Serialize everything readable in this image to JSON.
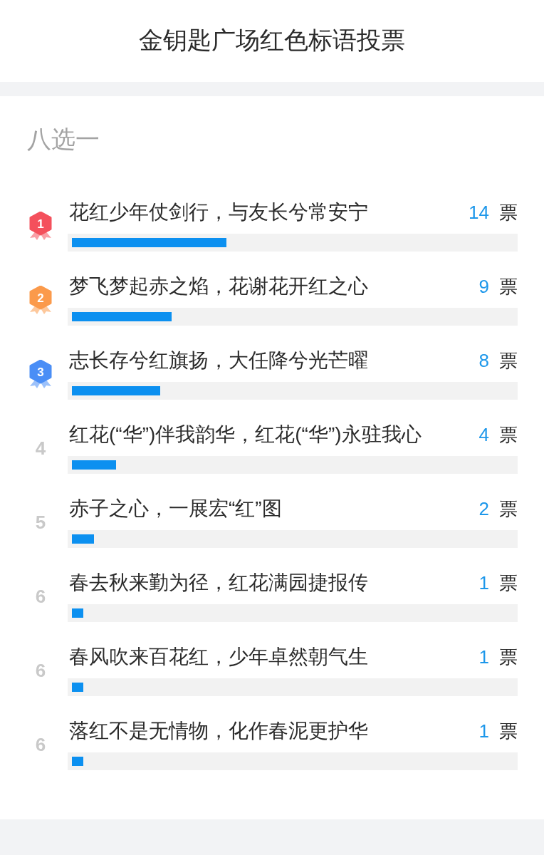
{
  "header": {
    "title": "金钥匙广场红色标语投票"
  },
  "poll": {
    "subtitle": "八选一",
    "options": [
      {
        "kind": "medal",
        "rank": "1",
        "color": "#f4505c",
        "text": "花红少年仗剑行，与友长兮常安宁",
        "votes": "14",
        "unit": "票",
        "level": 0.35
      },
      {
        "kind": "medal",
        "rank": "2",
        "color": "#fb9a4b",
        "text": "梦飞梦起赤之焰，花谢花开红之心",
        "votes": "9",
        "unit": "票",
        "level": 0.225
      },
      {
        "kind": "medal",
        "rank": "3",
        "color": "#4a8ef6",
        "text": "志长存兮红旗扬，大任降兮光芒曜",
        "votes": "8",
        "unit": "票",
        "level": 0.2
      },
      {
        "kind": "plain",
        "rank": "4",
        "text": "红花(“华”)伴我韵华，红花(“华”)永驻我心",
        "votes": "4",
        "unit": "票",
        "level": 0.1
      },
      {
        "kind": "plain",
        "rank": "5",
        "text": "赤子之心，一展宏“红”图",
        "votes": "2",
        "unit": "票",
        "level": 0.05
      },
      {
        "kind": "plain",
        "rank": "6",
        "text": "春去秋来勤为径，红花满园捷报传",
        "votes": "1",
        "unit": "票",
        "level": 0.025
      },
      {
        "kind": "plain",
        "rank": "6",
        "text": "春风吹来百花红，少年卓然朝气生",
        "votes": "1",
        "unit": "票",
        "level": 0.025
      },
      {
        "kind": "plain",
        "rank": "6",
        "text": "落红不是无情物，化作春泥更护华",
        "votes": "1",
        "unit": "票",
        "level": 0.025
      }
    ]
  }
}
